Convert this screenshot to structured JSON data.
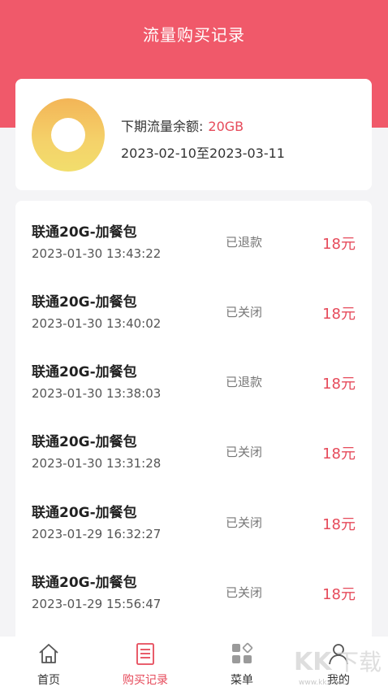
{
  "header": {
    "title": "流量购买记录",
    "bg_color": "#f0596a"
  },
  "summary": {
    "remain_label": "下期流量余额:",
    "remain_value": "20GB",
    "period": "2023-02-10至2023-03-11",
    "donut_colors": [
      "#f3b557",
      "#f2de6c"
    ]
  },
  "records": [
    {
      "name": "联通20G-加餐包",
      "time": "2023-01-30 13:43:22",
      "status": "已退款",
      "price": "18元"
    },
    {
      "name": "联通20G-加餐包",
      "time": "2023-01-30 13:40:02",
      "status": "已关闭",
      "price": "18元"
    },
    {
      "name": "联通20G-加餐包",
      "time": "2023-01-30 13:38:03",
      "status": "已退款",
      "price": "18元"
    },
    {
      "name": "联通20G-加餐包",
      "time": "2023-01-30 13:31:28",
      "status": "已关闭",
      "price": "18元"
    },
    {
      "name": "联通20G-加餐包",
      "time": "2023-01-29 16:32:27",
      "status": "已关闭",
      "price": "18元"
    },
    {
      "name": "联通20G-加餐包",
      "time": "2023-01-29 15:56:47",
      "status": "已关闭",
      "price": "18元"
    }
  ],
  "tabbar": {
    "items": [
      {
        "label": "首页",
        "icon": "home-icon",
        "active": false
      },
      {
        "label": "购买记录",
        "icon": "document-list-icon",
        "active": true
      },
      {
        "label": "菜单",
        "icon": "grid-menu-icon",
        "active": false
      },
      {
        "label": "我的",
        "icon": "user-icon",
        "active": false
      }
    ]
  },
  "watermark": {
    "text": "KK下载",
    "url_text": "www.kkx.net"
  },
  "colors": {
    "accent": "#e64a5a",
    "background": "#f4f4f6"
  }
}
